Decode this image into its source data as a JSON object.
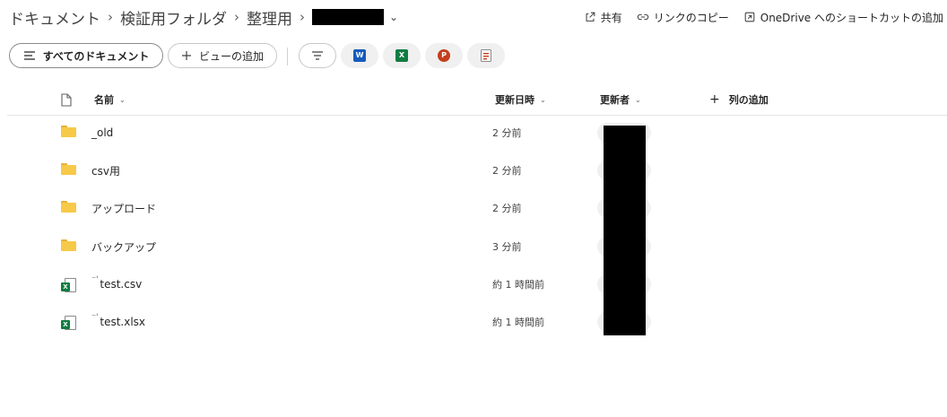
{
  "breadcrumb": {
    "items": [
      "ドキュメント",
      "検証用フォルダ",
      "整理用"
    ],
    "separator": "›",
    "current_chevron": "⌄"
  },
  "top_actions": {
    "share": "共有",
    "copy_link": "リンクのコピー",
    "onedrive_shortcut": "OneDrive へのショートカットの追加"
  },
  "view_bar": {
    "all_documents": "すべてのドキュメント",
    "add_view": "ビューの追加"
  },
  "columns": {
    "name": "名前",
    "modified": "更新日時",
    "modified_by": "更新者",
    "add_column": "列の追加"
  },
  "rows": [
    {
      "type": "folder",
      "name": "_old",
      "modified": "2 分前"
    },
    {
      "type": "folder",
      "name": "csv用",
      "modified": "2 分前"
    },
    {
      "type": "folder",
      "name": "アップロード",
      "modified": "2 分前"
    },
    {
      "type": "folder",
      "name": "バックアップ",
      "modified": "3 分前"
    },
    {
      "type": "excel-file",
      "name": "test.csv",
      "modified": "約 1 時間前",
      "new_mark": "⁻ʾ"
    },
    {
      "type": "excel-file",
      "name": "test.xlsx",
      "modified": "約 1 時間前",
      "new_mark": "⁻ʾ"
    }
  ],
  "colors": {
    "folder": "#f7c948",
    "word": "#185abd",
    "excel": "#107c41",
    "powerpoint": "#c43e1c"
  }
}
